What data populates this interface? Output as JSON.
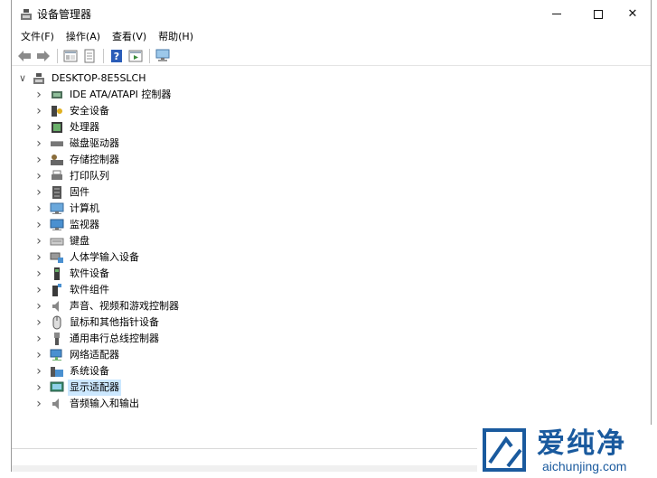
{
  "window": {
    "title": "设备管理器",
    "controls": {
      "minimize": "─",
      "maximize": "☐",
      "close": "✕"
    }
  },
  "menubar": {
    "items": [
      {
        "label": "文件(F)"
      },
      {
        "label": "操作(A)"
      },
      {
        "label": "查看(V)"
      },
      {
        "label": "帮助(H)"
      }
    ]
  },
  "toolbar": {
    "buttons": [
      "back-icon",
      "forward-icon",
      "properties-view-icon",
      "details-icon",
      "help-icon",
      "run-icon",
      "monitor-scan-icon"
    ]
  },
  "tree": {
    "root": {
      "label": "DESKTOP-8E5SLCH",
      "expanded": true
    },
    "categories": [
      {
        "label": "IDE ATA/ATAPI 控制器",
        "icon": "ide-controller-icon"
      },
      {
        "label": "安全设备",
        "icon": "security-device-icon"
      },
      {
        "label": "处理器",
        "icon": "processor-icon"
      },
      {
        "label": "磁盘驱动器",
        "icon": "disk-drive-icon"
      },
      {
        "label": "存储控制器",
        "icon": "storage-controller-icon"
      },
      {
        "label": "打印队列",
        "icon": "print-queue-icon"
      },
      {
        "label": "固件",
        "icon": "firmware-icon"
      },
      {
        "label": "计算机",
        "icon": "computer-icon"
      },
      {
        "label": "监视器",
        "icon": "monitor-icon"
      },
      {
        "label": "键盘",
        "icon": "keyboard-icon"
      },
      {
        "label": "人体学输入设备",
        "icon": "hid-icon"
      },
      {
        "label": "软件设备",
        "icon": "software-device-icon"
      },
      {
        "label": "软件组件",
        "icon": "software-component-icon"
      },
      {
        "label": "声音、视频和游戏控制器",
        "icon": "sound-icon"
      },
      {
        "label": "鼠标和其他指针设备",
        "icon": "mouse-icon"
      },
      {
        "label": "通用串行总线控制器",
        "icon": "usb-icon"
      },
      {
        "label": "网络适配器",
        "icon": "network-adapter-icon"
      },
      {
        "label": "系统设备",
        "icon": "system-device-icon"
      },
      {
        "label": "显示适配器",
        "icon": "display-adapter-icon",
        "selected": true
      },
      {
        "label": "音频输入和输出",
        "icon": "audio-io-icon"
      }
    ]
  },
  "watermark": {
    "brand": "爱纯净",
    "url": "aichunjing.com"
  },
  "colors": {
    "selection": "#cce8ff",
    "brand": "#1a5a9e"
  }
}
